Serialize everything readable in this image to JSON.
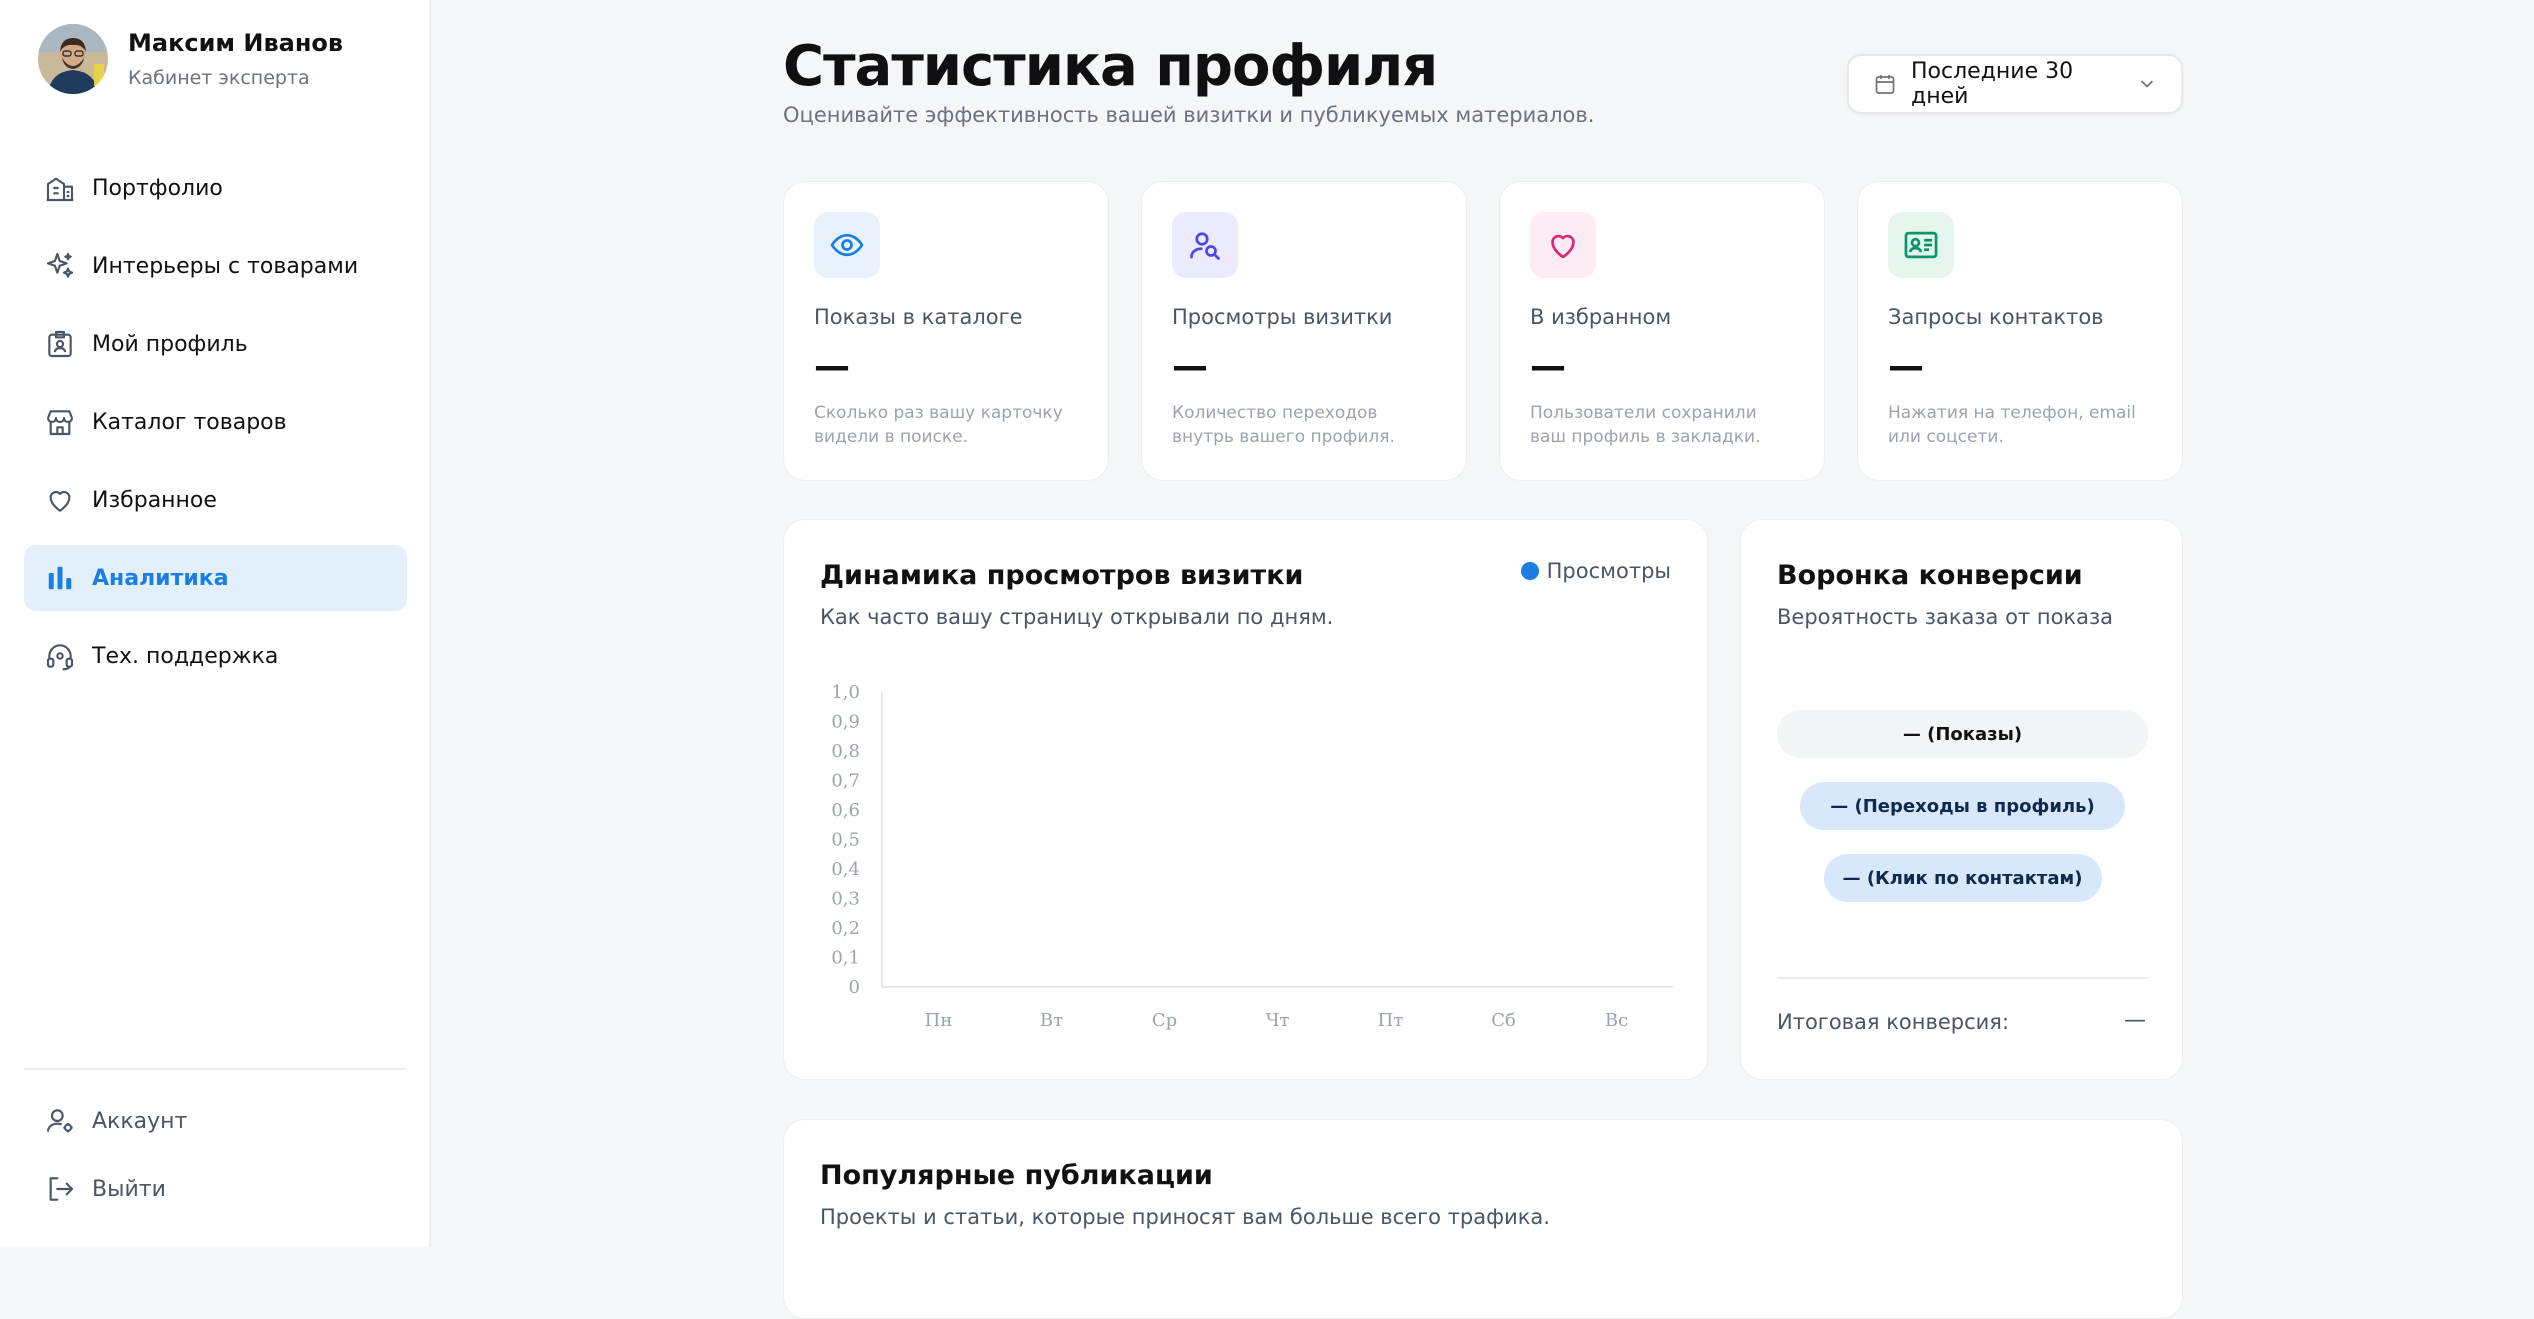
{
  "user": {
    "name": "Максим Иванов",
    "role": "Кабинет эксперта"
  },
  "nav": [
    {
      "label": "Портфолио",
      "icon": "building-icon"
    },
    {
      "label": "Интерьеры с товарами",
      "icon": "sparkles-icon"
    },
    {
      "label": "Мой профиль",
      "icon": "id-badge-icon"
    },
    {
      "label": "Каталог товаров",
      "icon": "store-icon"
    },
    {
      "label": "Избранное",
      "icon": "heart-icon"
    },
    {
      "label": "Аналитика",
      "icon": "bar-chart-icon",
      "active": true
    },
    {
      "label": "Тех. поддержка",
      "icon": "headset-icon"
    }
  ],
  "nav_bottom": [
    {
      "label": "Аккаунт",
      "icon": "user-gear-icon"
    },
    {
      "label": "Выйти",
      "icon": "logout-icon"
    }
  ],
  "header": {
    "title": "Статистика профиля",
    "subtitle": "Оценивайте эффективность вашей визитки и публикуемых материалов.",
    "period": "Последние 30 дней"
  },
  "cards": [
    {
      "title": "Показы в каталоге",
      "value": "—",
      "desc": "Сколько раз вашу карточку видели в поиске.",
      "icon": "eye-icon",
      "color": "#1a7fe0",
      "bg": "#e8f2fd"
    },
    {
      "title": "Просмотры визитки",
      "value": "—",
      "desc": "Количество переходов внутрь вашего профиля.",
      "icon": "user-search-icon",
      "color": "#4f46e5",
      "bg": "#eceafd"
    },
    {
      "title": "В избранном",
      "value": "—",
      "desc": "Пользователи сохранили ваш профиль в закладки.",
      "icon": "heart-icon",
      "color": "#db2777",
      "bg": "#fdecf3"
    },
    {
      "title": "Запросы контактов",
      "value": "—",
      "desc": "Нажатия на телефон, email или соцсети.",
      "icon": "contact-card-icon",
      "color": "#059669",
      "bg": "#e6f6ef"
    }
  ],
  "chart_panel": {
    "title": "Динамика просмотров визитки",
    "subtitle": "Как часто вашу страницу открывали по дням.",
    "legend": "Просмотры"
  },
  "chart_data": {
    "type": "line",
    "categories": [
      "Пн",
      "Вт",
      "Ср",
      "Чт",
      "Пт",
      "Сб",
      "Вс"
    ],
    "series": [
      {
        "name": "Просмотры",
        "values": []
      }
    ],
    "y_ticks": [
      "0",
      "0,1",
      "0,2",
      "0,3",
      "0,4",
      "0,5",
      "0,6",
      "0,7",
      "0,8",
      "0,9",
      "1,0"
    ],
    "ylim": [
      0,
      1
    ],
    "grid": false,
    "legend_position": "top-right",
    "color": "#1a7fe0"
  },
  "funnel": {
    "title": "Воронка конверсии",
    "subtitle": "Вероятность заказа от показа",
    "steps": [
      "— (Показы)",
      "— (Переходы в профиль)",
      "— (Клик по контактам)"
    ],
    "total_label": "Итоговая конверсия:",
    "total_value": "—"
  },
  "publications": {
    "title": "Популярные публикации",
    "subtitle": "Проекты и статьи, которые приносят вам больше всего трафика."
  }
}
